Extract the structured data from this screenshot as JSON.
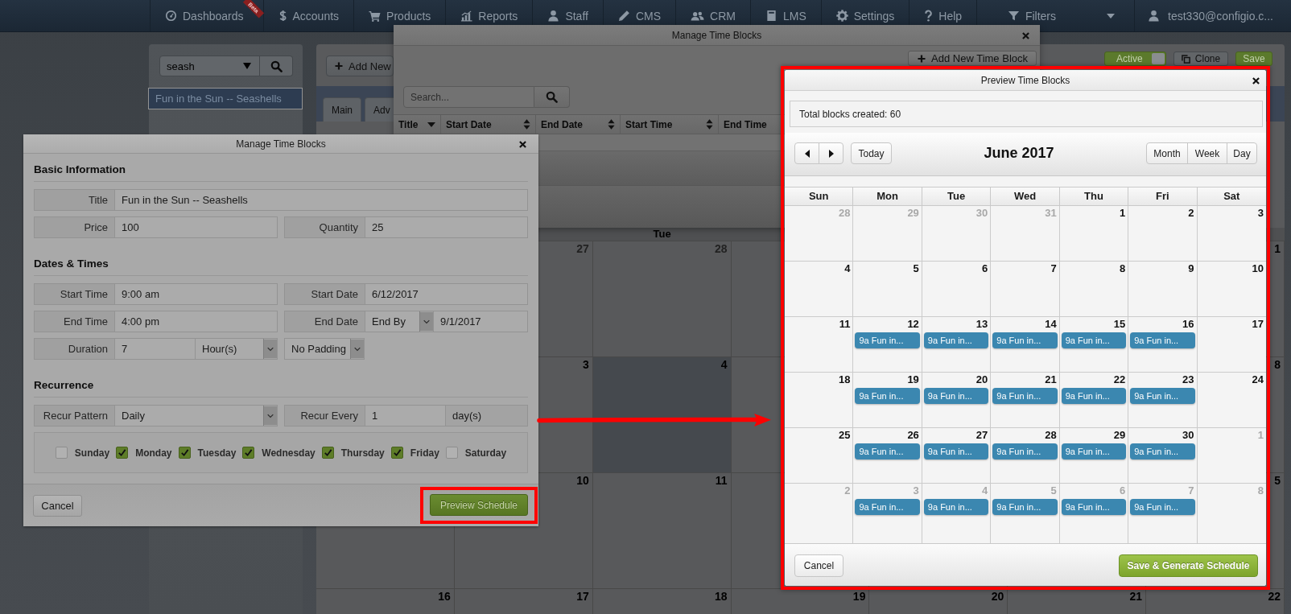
{
  "nav": {
    "items": [
      {
        "label": "Dashboards",
        "badge": "Beta"
      },
      {
        "label": "Accounts"
      },
      {
        "label": "Products"
      },
      {
        "label": "Reports"
      },
      {
        "label": "Staff"
      },
      {
        "label": "CMS"
      },
      {
        "label": "CRM"
      },
      {
        "label": "LMS"
      },
      {
        "label": "Settings"
      },
      {
        "label": "Help"
      }
    ],
    "filters": "Filters",
    "user": "test330@configio.c..."
  },
  "sidebar": {
    "search": {
      "value": "seash"
    },
    "items": [
      {
        "label": "Fun in the Sun -- Seashells",
        "selected": true
      }
    ]
  },
  "main": {
    "add_button": "Add New",
    "toggle": {
      "label": "Active",
      "on": true
    },
    "clone_button": "Clone",
    "save_button": "Save",
    "tabs": [
      {
        "label": "Main"
      },
      {
        "label": "Adv"
      }
    ],
    "calendar": {
      "headers": {
        "tue": "Tue"
      },
      "weeks": [
        {
          "mon": {
            "day": "27",
            "other_month": true,
            "today": false
          },
          "tue": {
            "day": "28",
            "other_month": true,
            "today": false
          },
          "sat": {
            "day": "1",
            "other_month": false,
            "today": false
          }
        },
        {
          "mon": {
            "day": "3",
            "other_month": false,
            "today": false
          },
          "tue": {
            "day": "4",
            "other_month": false,
            "today": true
          },
          "sat": {
            "day": "8",
            "other_month": false,
            "today": false
          }
        },
        {
          "mon": {
            "day": "10",
            "other_month": false,
            "today": false
          },
          "tue": {
            "day": "11",
            "other_month": false,
            "today": false
          },
          "sat": {
            "day": "5",
            "other_month": false,
            "today": false
          }
        },
        {
          "sun": {
            "day": "16",
            "other_month": false,
            "today": false
          },
          "mon": {
            "day": "17",
            "other_month": false,
            "today": false
          },
          "tue": {
            "day": "18",
            "other_month": false,
            "today": false
          },
          "wed": {
            "day": "19",
            "other_month": false,
            "today": false
          },
          "thu": {
            "day": "20",
            "other_month": false,
            "today": false
          },
          "fri": {
            "day": "21",
            "other_month": false,
            "today": false
          },
          "sat": {
            "day": "22",
            "other_month": false,
            "today": false
          }
        }
      ]
    }
  },
  "list_dialog": {
    "title": "Manage Time Blocks",
    "add_button": "Add New Time Block",
    "search": {
      "placeholder": "Search..."
    },
    "columns": [
      {
        "label": "Title",
        "sorted": true
      },
      {
        "label": "Start Date",
        "sorted": false
      },
      {
        "label": "End Date",
        "sorted": false
      },
      {
        "label": "Start Time",
        "sorted": false
      },
      {
        "label": "End Time"
      }
    ]
  },
  "edit_dialog": {
    "title": "Manage Time Blocks",
    "basic": {
      "heading": "Basic Information",
      "title": {
        "label": "Title",
        "value": "Fun in the Sun -- Seashells"
      },
      "price": {
        "label": "Price",
        "value": "100"
      },
      "quantity": {
        "label": "Quantity",
        "value": "25"
      }
    },
    "dates": {
      "heading": "Dates & Times",
      "start_time": {
        "label": "Start Time",
        "value": "9:00 am"
      },
      "start_date": {
        "label": "Start Date",
        "value": "6/12/2017"
      },
      "end_time": {
        "label": "End Time",
        "value": "4:00 pm"
      },
      "end_date": {
        "label": "End Date",
        "mode": "End By",
        "value": "9/1/2017"
      },
      "duration": {
        "label": "Duration",
        "value": "7",
        "unit": "Hour(s)"
      },
      "padding": "No Padding"
    },
    "recurrence": {
      "heading": "Recurrence",
      "pattern": {
        "label": "Recur Pattern",
        "value": "Daily"
      },
      "every": {
        "label": "Recur Every",
        "value": "1",
        "unit": "day(s)"
      },
      "days": [
        {
          "label": "Sunday",
          "checked": false
        },
        {
          "label": "Monday",
          "checked": true
        },
        {
          "label": "Tuesday",
          "checked": true
        },
        {
          "label": "Wednesday",
          "checked": true
        },
        {
          "label": "Thursday",
          "checked": true
        },
        {
          "label": "Friday",
          "checked": true
        },
        {
          "label": "Saturday",
          "checked": false
        }
      ]
    },
    "cancel_button": "Cancel",
    "preview_button": "Preview Schedule"
  },
  "preview_dialog": {
    "title": "Preview Time Blocks",
    "summary": "Total blocks created: 60",
    "calendar": {
      "title": "June 2017",
      "today_button": "Today",
      "views": [
        "Month",
        "Week",
        "Day"
      ],
      "weekdays": [
        "Sun",
        "Mon",
        "Tue",
        "Wed",
        "Thu",
        "Fri",
        "Sat"
      ],
      "weeks": [
        {
          "days": [
            {
              "day": "28",
              "other_month": true
            },
            {
              "day": "29",
              "other_month": true
            },
            {
              "day": "30",
              "other_month": true
            },
            {
              "day": "31",
              "other_month": true
            },
            {
              "day": "1",
              "other_month": false
            },
            {
              "day": "2",
              "other_month": false
            },
            {
              "day": "3",
              "other_month": false
            }
          ]
        },
        {
          "days": [
            {
              "day": "4",
              "other_month": false
            },
            {
              "day": "5",
              "other_month": false
            },
            {
              "day": "6",
              "other_month": false
            },
            {
              "day": "7",
              "other_month": false
            },
            {
              "day": "8",
              "other_month": false
            },
            {
              "day": "9",
              "other_month": false
            },
            {
              "day": "10",
              "other_month": false
            }
          ]
        },
        {
          "days": [
            {
              "day": "11",
              "other_month": false
            },
            {
              "day": "12",
              "other_month": false,
              "events": [
                "9a Fun in..."
              ]
            },
            {
              "day": "13",
              "other_month": false,
              "events": [
                "9a Fun in..."
              ]
            },
            {
              "day": "14",
              "other_month": false,
              "events": [
                "9a Fun in..."
              ]
            },
            {
              "day": "15",
              "other_month": false,
              "events": [
                "9a Fun in..."
              ]
            },
            {
              "day": "16",
              "other_month": false,
              "events": [
                "9a Fun in..."
              ]
            },
            {
              "day": "17",
              "other_month": false
            }
          ]
        },
        {
          "days": [
            {
              "day": "18",
              "other_month": false
            },
            {
              "day": "19",
              "other_month": false,
              "events": [
                "9a Fun in..."
              ]
            },
            {
              "day": "20",
              "other_month": false,
              "events": [
                "9a Fun in..."
              ]
            },
            {
              "day": "21",
              "other_month": false,
              "events": [
                "9a Fun in..."
              ]
            },
            {
              "day": "22",
              "other_month": false,
              "events": [
                "9a Fun in..."
              ]
            },
            {
              "day": "23",
              "other_month": false,
              "events": [
                "9a Fun in..."
              ]
            },
            {
              "day": "24",
              "other_month": false
            }
          ]
        },
        {
          "days": [
            {
              "day": "25",
              "other_month": false
            },
            {
              "day": "26",
              "other_month": false,
              "events": [
                "9a Fun in..."
              ]
            },
            {
              "day": "27",
              "other_month": false,
              "events": [
                "9a Fun in..."
              ]
            },
            {
              "day": "28",
              "other_month": false,
              "events": [
                "9a Fun in..."
              ]
            },
            {
              "day": "29",
              "other_month": false,
              "events": [
                "9a Fun in..."
              ]
            },
            {
              "day": "30",
              "other_month": false,
              "events": [
                "9a Fun in..."
              ]
            },
            {
              "day": "1",
              "other_month": true
            }
          ]
        },
        {
          "days": [
            {
              "day": "2",
              "other_month": true
            },
            {
              "day": "3",
              "other_month": true,
              "events": [
                "9a Fun in..."
              ]
            },
            {
              "day": "4",
              "other_month": true,
              "events": [
                "9a Fun in..."
              ]
            },
            {
              "day": "5",
              "other_month": true,
              "events": [
                "9a Fun in..."
              ]
            },
            {
              "day": "6",
              "other_month": true,
              "events": [
                "9a Fun in..."
              ]
            },
            {
              "day": "7",
              "other_month": true,
              "events": [
                "9a Fun in..."
              ]
            },
            {
              "day": "8",
              "other_month": true
            }
          ]
        }
      ]
    },
    "cancel_button": "Cancel",
    "save_button": "Save & Generate Schedule"
  }
}
